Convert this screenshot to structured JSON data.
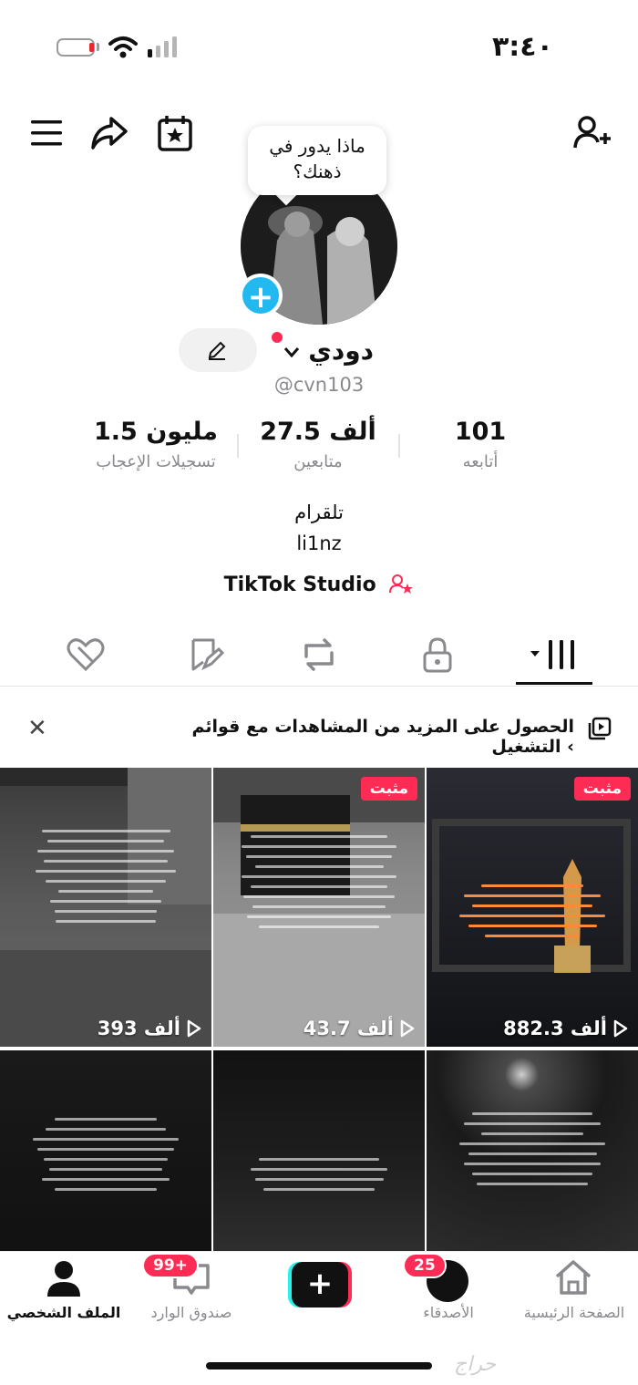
{
  "status_bar": {
    "time": "٣:٤٠"
  },
  "profile": {
    "thought_bubble": "ماذا يدور في ذهنك؟",
    "display_name": "دودي",
    "username": "@cvn103",
    "stats": [
      {
        "value": "101",
        "label": "أتابعه"
      },
      {
        "value": "27.5 ألف",
        "label": "متابعين"
      },
      {
        "value": "1.5 مليون",
        "label": "تسجيلات الإعجاب"
      }
    ],
    "bio_line1": "تلقرام",
    "bio_line2": "li1nz",
    "studio_label": "TikTok Studio"
  },
  "playlist_banner": "الحصول على المزيد من المشاهدات مع قوائم التشغيل ‹",
  "videos": [
    {
      "pinned_label": "مثبت",
      "views": "882.3 ألف"
    },
    {
      "pinned_label": "مثبت",
      "views": "43.7 ألف"
    },
    {
      "pinned_label": "",
      "views": "393 ألف"
    }
  ],
  "bottom_nav": {
    "home": "الصفحة الرئيسية",
    "friends": "الأصدقاء",
    "friends_badge": "25",
    "inbox": "صندوق الوارد",
    "inbox_badge": "99+",
    "profile": "الملف الشخصي"
  },
  "watermark": "حراج",
  "colors": {
    "accent": "#fe2c55",
    "badge_blue": "#22b8f0"
  }
}
